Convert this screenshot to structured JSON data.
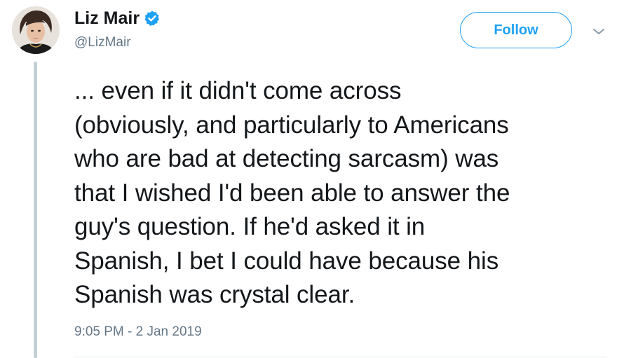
{
  "author": {
    "display_name": "Liz Mair",
    "handle": "@LizMair",
    "verified": true,
    "avatar_icon": "profile-photo"
  },
  "actions": {
    "follow_label": "Follow",
    "menu_icon": "chevron-down-icon"
  },
  "tweet": {
    "lines": [
      "... even if it didn't come across",
      "(obviously, and particularly to Americans",
      "who are bad at detecting sarcasm) was",
      "that I wished I'd been able to answer the",
      "guy's question. If he'd asked it in",
      "Spanish, I bet I could have because his",
      "Spanish was crystal clear."
    ],
    "timestamp": "9:05 PM - 2 Jan 2019"
  },
  "colors": {
    "accent": "#1da1f2",
    "text": "#14171a",
    "muted": "#657786",
    "thread_line": "#c4cfd6"
  }
}
